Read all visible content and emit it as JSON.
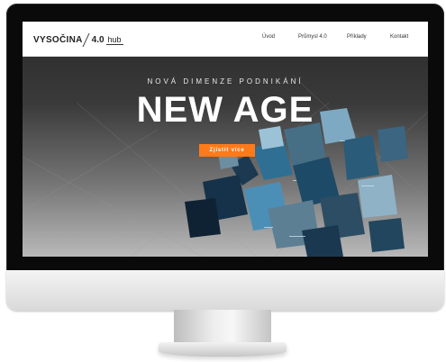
{
  "logo": {
    "word": "VYSOČINA",
    "number": "4.0",
    "suffix": "hub"
  },
  "nav": {
    "items": [
      {
        "label": "Úvod"
      },
      {
        "label": "Průmysl 4.0"
      },
      {
        "label": "Příklady"
      },
      {
        "label": "Kontakt"
      }
    ]
  },
  "hero": {
    "subtitle": "NOVÁ DIMENZE PODNIKÁNÍ",
    "title": "NEW AGE",
    "cta_label": "Zjistit více"
  },
  "colors": {
    "accent": "#ff7a1a",
    "navbar": "#ffffff",
    "hero_dark": "#2a2a2a"
  },
  "icons": [
    "crystal-shards-decoration"
  ]
}
